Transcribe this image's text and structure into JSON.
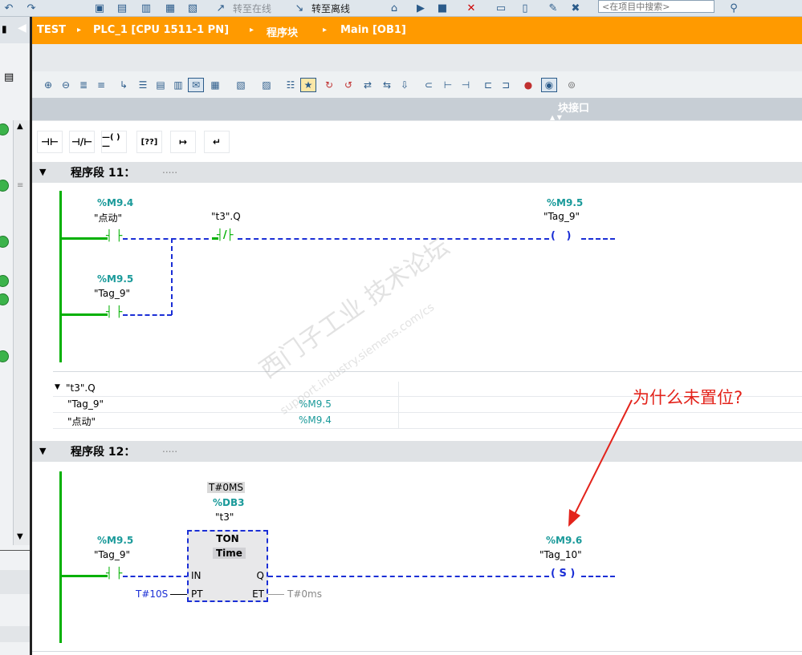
{
  "toolbar": {
    "go_online": "转至在线",
    "go_offline": "转至离线",
    "search_placeholder": "<在项目中搜索>"
  },
  "breadcrumb": [
    "TEST",
    "PLC_1 [CPU 1511-1 PN]",
    "程序块",
    "Main [OB1]"
  ],
  "breadcrumb_sep": "▸",
  "interface_label": "块接口",
  "favorites": [
    "⊣⊢",
    "⊣/⊢",
    "—( )—",
    "[??]",
    "↦",
    "↵"
  ],
  "network11": {
    "title": "程序段 11：",
    "comment": ".....",
    "contact1_addr": "%M9.4",
    "contact1_tag": "\"点动\"",
    "contact2_tag": "\"t3\".Q",
    "coil_addr": "%M9.5",
    "coil_tag": "\"Tag_9\"",
    "parallel_addr": "%M9.5",
    "parallel_tag": "\"Tag_9\"",
    "info_rows": [
      {
        "name": "\"t3\".Q",
        "addr": ""
      },
      {
        "name": "\"Tag_9\"",
        "addr": "%M9.5"
      },
      {
        "name": "\"点动\"",
        "addr": "%M9.4"
      }
    ]
  },
  "network12": {
    "title": "程序段 12：",
    "comment": ".....",
    "db_pt": "T#0MS",
    "db_addr": "%DB3",
    "db_tag": "\"t3\"",
    "contact_addr": "%M9.5",
    "contact_tag": "\"Tag_9\"",
    "timer_type": "TON",
    "timer_sub": "Time",
    "in_label": "IN",
    "q_label": "Q",
    "pt_label": "PT",
    "et_label": "ET",
    "pt_value": "T#10S",
    "et_value": "T#0ms",
    "coil_addr": "%M9.6",
    "coil_tag": "\"Tag_10\"",
    "coil_symbol": "( S )"
  },
  "annotation": "为什么未置位?",
  "watermark": [
    "西门子工业 技术论坛",
    "support.industry.siemens.com/cs"
  ],
  "colors": {
    "breadcrumb_bg": "#ff9a00",
    "power_flow": "#00b000",
    "no_flow": "#1b2fd6",
    "address": "#1a9a9a",
    "annotation": "#e3231b"
  }
}
